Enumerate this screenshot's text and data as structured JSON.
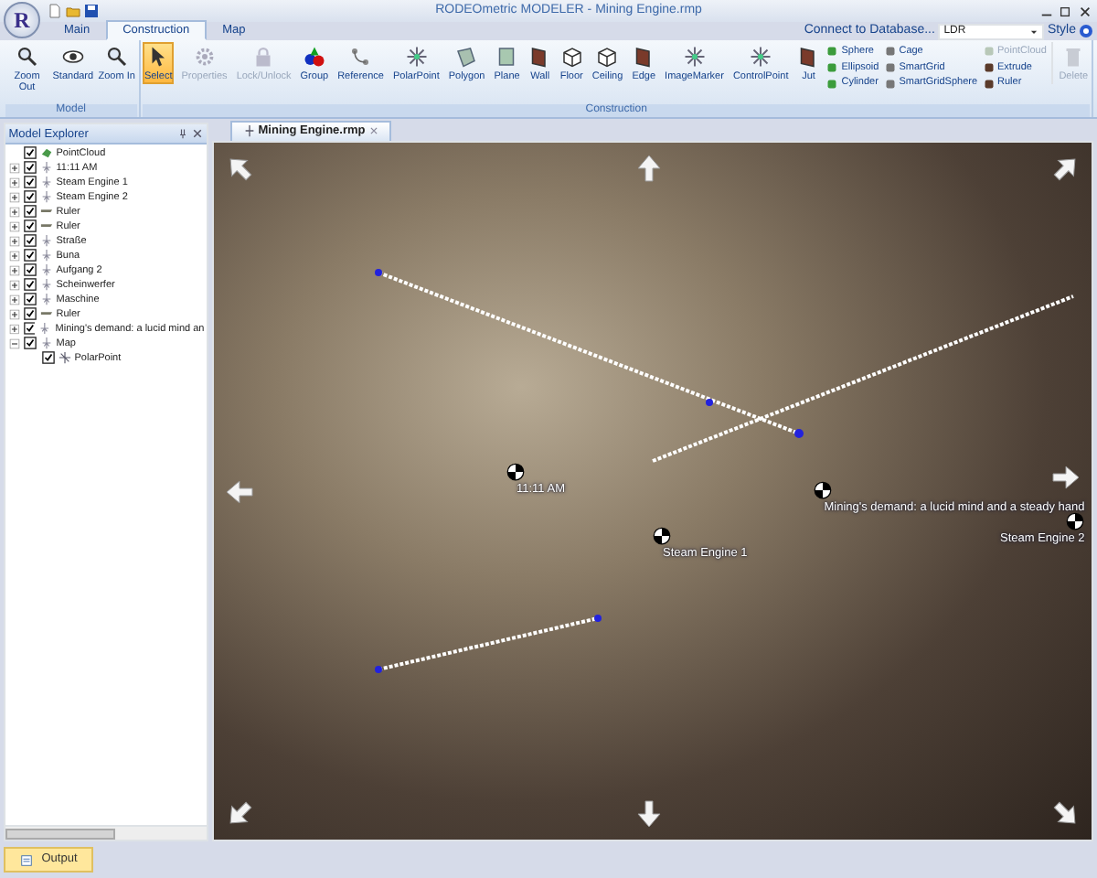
{
  "window": {
    "title": "RODEOmetric MODELER - Mining Engine.rmp",
    "logo": "R"
  },
  "ribbon_tabs": [
    {
      "label": "Main",
      "selected": false
    },
    {
      "label": "Construction",
      "selected": true
    },
    {
      "label": "Map",
      "selected": false
    }
  ],
  "connect": {
    "label": "Connect to Database...",
    "value": "LDR",
    "style_label": "Style"
  },
  "groups": [
    {
      "label": "Model",
      "buttons": [
        {
          "label": "Zoom Out",
          "selected": false,
          "disabled": false
        },
        {
          "label": "Standard",
          "selected": false,
          "disabled": false
        },
        {
          "label": "Zoom In",
          "selected": false,
          "disabled": false
        }
      ]
    },
    {
      "label": "Construction",
      "buttons": [
        {
          "label": "Select",
          "selected": true,
          "disabled": false
        },
        {
          "label": "Properties",
          "selected": false,
          "disabled": true
        },
        {
          "label": "Lock/Unlock",
          "selected": false,
          "disabled": true
        },
        {
          "label": "Group",
          "selected": false,
          "disabled": false
        },
        {
          "label": "Reference",
          "selected": false,
          "disabled": false
        },
        {
          "label": "PolarPoint",
          "selected": false,
          "disabled": false
        },
        {
          "label": "Polygon",
          "selected": false,
          "disabled": false
        },
        {
          "label": "Plane",
          "selected": false,
          "disabled": false
        },
        {
          "label": "Wall",
          "selected": false,
          "disabled": false
        },
        {
          "label": "Floor",
          "selected": false,
          "disabled": false
        },
        {
          "label": "Ceiling",
          "selected": false,
          "disabled": false
        },
        {
          "label": "Edge",
          "selected": false,
          "disabled": false
        },
        {
          "label": "ImageMarker",
          "selected": false,
          "disabled": false
        },
        {
          "label": "ControlPoint",
          "selected": false,
          "disabled": false
        },
        {
          "label": "Jut",
          "selected": false,
          "disabled": false
        }
      ],
      "small": [
        [
          {
            "label": "Sphere",
            "disabled": false
          },
          {
            "label": "Ellipsoid",
            "disabled": false
          },
          {
            "label": "Cylinder",
            "disabled": false
          }
        ],
        [
          {
            "label": "Cage",
            "disabled": false
          },
          {
            "label": "SmartGrid",
            "disabled": false
          },
          {
            "label": "SmartGridSphere",
            "disabled": false
          }
        ],
        [
          {
            "label": "PointCloud",
            "disabled": true
          },
          {
            "label": "Extrude",
            "disabled": false
          },
          {
            "label": "Ruler",
            "disabled": false
          }
        ]
      ],
      "trailing": [
        {
          "label": "Delete",
          "selected": false,
          "disabled": true
        }
      ]
    }
  ],
  "explorer": {
    "title": "Model Explorer",
    "items": [
      {
        "label": "PointCloud",
        "kind": "cloud",
        "checked": true
      },
      {
        "label": "11:11 AM",
        "kind": "marker",
        "checked": true,
        "expanded": false
      },
      {
        "label": "Steam Engine 1",
        "kind": "marker",
        "checked": true,
        "expanded": false
      },
      {
        "label": "Steam Engine 2",
        "kind": "marker",
        "checked": true,
        "expanded": false
      },
      {
        "label": "Ruler",
        "kind": "ruler",
        "checked": true,
        "expanded": false
      },
      {
        "label": "Ruler",
        "kind": "ruler",
        "checked": true,
        "expanded": false
      },
      {
        "label": "Straße",
        "kind": "marker",
        "checked": true,
        "expanded": false
      },
      {
        "label": "Buna",
        "kind": "marker",
        "checked": true,
        "expanded": false
      },
      {
        "label": "Aufgang 2",
        "kind": "marker",
        "checked": true,
        "expanded": false
      },
      {
        "label": "Scheinwerfer",
        "kind": "marker",
        "checked": true,
        "expanded": false
      },
      {
        "label": "Maschine",
        "kind": "marker",
        "checked": true,
        "expanded": false
      },
      {
        "label": "Ruler",
        "kind": "ruler",
        "checked": true,
        "expanded": false
      },
      {
        "label": "Mining's demand: a lucid mind an",
        "kind": "marker",
        "checked": true,
        "expanded": false
      },
      {
        "label": "Map",
        "kind": "marker",
        "checked": true,
        "expanded": true,
        "children": [
          {
            "label": "PolarPoint",
            "kind": "polar",
            "checked": true
          }
        ]
      }
    ]
  },
  "document": {
    "tab": "Mining Engine.rmp",
    "markers": [
      {
        "label": "11:11 AM"
      },
      {
        "label": "Steam Engine 1"
      },
      {
        "label": "Mining's demand: a lucid mind and a steady hand"
      },
      {
        "label": "Steam Engine 2"
      }
    ]
  },
  "output": {
    "tab": "Output"
  }
}
